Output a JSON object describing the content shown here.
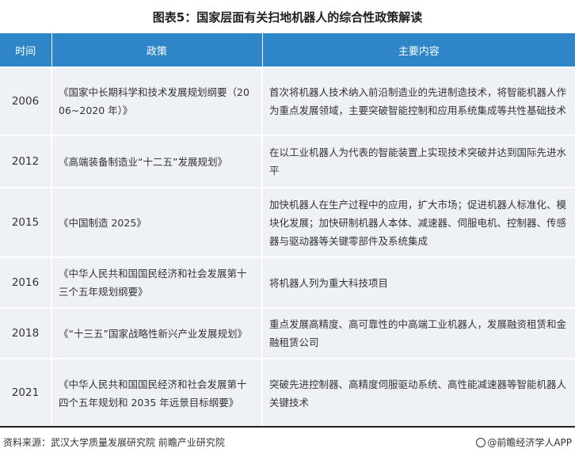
{
  "title": "图表5：国家层面有关扫地机器人的综合性政策解读",
  "table": {
    "headers": [
      "时间",
      "政策",
      "主要内容"
    ],
    "rows": [
      {
        "year": "2006",
        "policy": "《国家中长期科学和技术发展规划纲要（2006~2020 年）》",
        "content": "首次将机器人技术纳入前沿制造业的先进制造技术，将智能机器人作为重点发展领域，主要突破智能控制和应用系统集成等共性基础技术"
      },
      {
        "year": "2012",
        "policy": "《高端装备制造业“十二五”发展规划》",
        "content": "在以工业机器人为代表的智能装置上实现技术突破并达到国际先进水平"
      },
      {
        "year": "2015",
        "policy": "《中国制造 2025》",
        "content": "加快机器人在生产过程中的应用，扩大市场；促进机器人标准化、模块化发展；加快研制机器人本体、减速器、伺服电机、控制器、传感器与驱动器等关键零部件及系统集成"
      },
      {
        "year": "2016",
        "policy": "《中华人民共和国国民经济和社会发展第十三个五年规划纲要》",
        "content": "将机器人列为重大科技项目"
      },
      {
        "year": "2018",
        "policy": "《“十三五”国家战略性新兴产业发展规划》",
        "content": "重点发展高精度、高可靠性的中高端工业机器人，发展融资租赁和金融租赁公司"
      },
      {
        "year": "2021",
        "policy": "《中华人民共和国国民经济和社会发展第十四个五年规划和 2035 年远景目标纲要》",
        "content": "突破先进控制器、高精度伺服驱动系统、高性能减速器等智能机器人关键技术"
      }
    ]
  },
  "footer": {
    "source": "资料来源：武汉大学质量发展研究院 前瞻产业研究院",
    "brand": "@前瞻经济学人APP"
  },
  "colors": {
    "header_bg": "#2e86c8",
    "row_bg": "#eef2f6"
  }
}
